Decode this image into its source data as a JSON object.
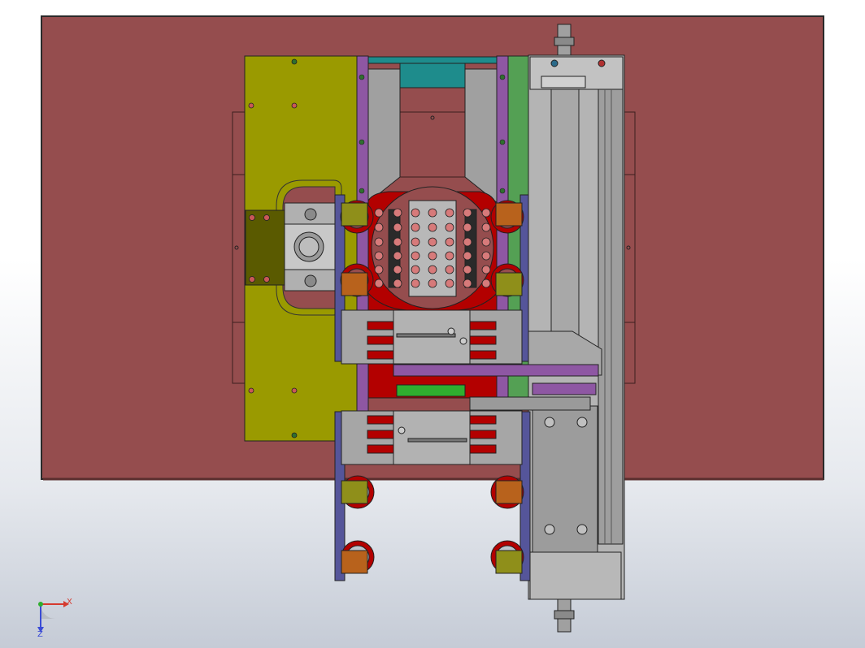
{
  "view": {
    "background_top": "#ffffff",
    "background_bottom": "#c5cbd6",
    "colors": {
      "base_plate": "#954d4e",
      "yellow_plate": "#9a9a00",
      "purple_bar": "#8e57a3",
      "blue_bar": "#55559a",
      "teal_bar": "#1e8c8c",
      "green_bar": "#54a054",
      "red_block": "#b30000",
      "grey_part": "#a0a0a0",
      "orange_pad": "#b8621c",
      "olive_pad": "#8f8f1a"
    }
  },
  "triad": {
    "x_label": "X",
    "z_label": "Z",
    "x_color": "#d63a2f",
    "z_color": "#3a4bd6"
  }
}
